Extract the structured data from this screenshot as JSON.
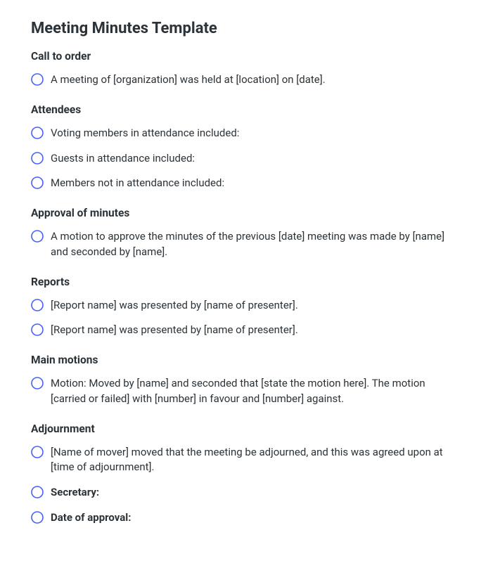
{
  "title": "Meeting Minutes Template",
  "sections": [
    {
      "heading": "Call to order",
      "items": [
        {
          "text": "A meeting of [organization] was held at [location] on [date].",
          "bold": false
        }
      ]
    },
    {
      "heading": "Attendees",
      "items": [
        {
          "text": "Voting members in attendance included:",
          "bold": false
        },
        {
          "text": "Guests in attendance included:",
          "bold": false
        },
        {
          "text": "Members not in attendance included:",
          "bold": false
        }
      ]
    },
    {
      "heading": "Approval of minutes",
      "items": [
        {
          "text": "A motion to approve the minutes of the previous [date] meeting was made by [name] and seconded by [name].",
          "bold": false
        }
      ]
    },
    {
      "heading": "Reports",
      "items": [
        {
          "text": "[Report name] was presented by [name of presenter].",
          "bold": false
        },
        {
          "text": "[Report name] was presented by [name of presenter].",
          "bold": false
        }
      ]
    },
    {
      "heading": "Main motions",
      "items": [
        {
          "text": "Motion: Moved by [name] and seconded that [state the motion here]. The motion [carried or failed] with [number] in favour and [number] against.",
          "bold": false
        }
      ]
    },
    {
      "heading": "Adjournment",
      "items": [
        {
          "text": "[Name of mover] moved that the meeting be adjourned, and this was agreed upon at [time of adjournment].",
          "bold": false
        },
        {
          "text": "Secretary:",
          "bold": true
        },
        {
          "text": "Date of approval:",
          "bold": true
        }
      ]
    }
  ],
  "colors": {
    "circle": "#4660f9"
  }
}
